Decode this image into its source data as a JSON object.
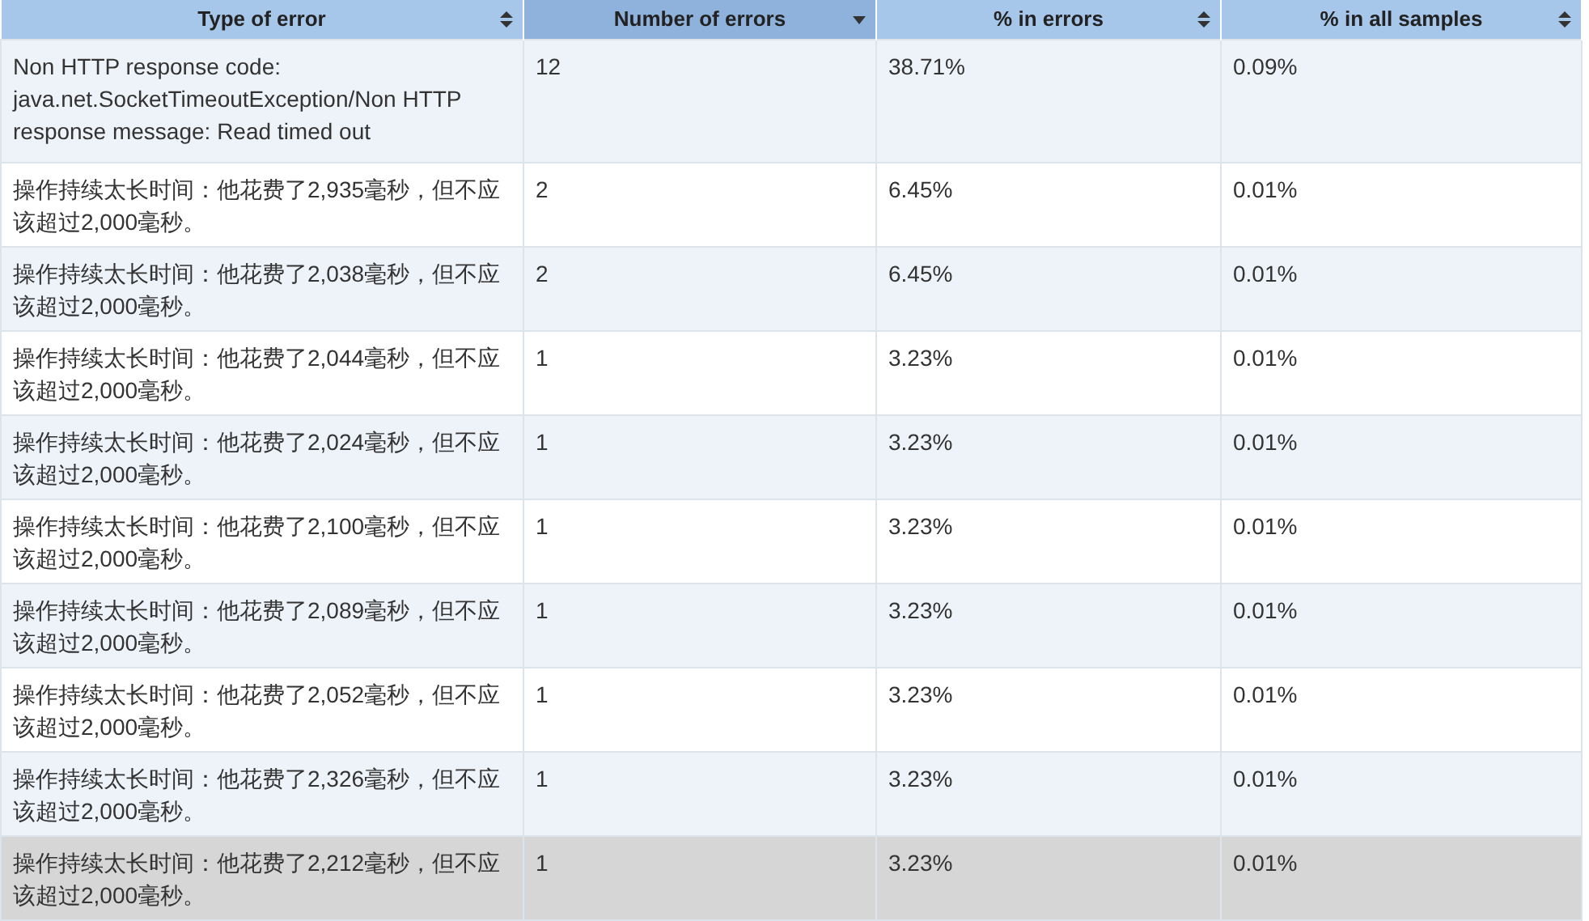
{
  "table": {
    "columns": [
      {
        "label": "Type of error",
        "sorted": false
      },
      {
        "label": "Number of errors",
        "sorted": true
      },
      {
        "label": "% in errors",
        "sorted": false
      },
      {
        "label": "% in all samples",
        "sorted": false
      }
    ],
    "rows": [
      {
        "cells": [
          "Non HTTP response code: java.net.SocketTimeoutException/Non HTTP response message: Read timed out",
          "12",
          "38.71%",
          "0.09%"
        ],
        "highlighted": false
      },
      {
        "cells": [
          "操作持续太长时间：他花费了2,935毫秒，但不应该超过2,000毫秒。",
          "2",
          "6.45%",
          "0.01%"
        ],
        "highlighted": false
      },
      {
        "cells": [
          "操作持续太长时间：他花费了2,038毫秒，但不应该超过2,000毫秒。",
          "2",
          "6.45%",
          "0.01%"
        ],
        "highlighted": false
      },
      {
        "cells": [
          "操作持续太长时间：他花费了2,044毫秒，但不应该超过2,000毫秒。",
          "1",
          "3.23%",
          "0.01%"
        ],
        "highlighted": false
      },
      {
        "cells": [
          "操作持续太长时间：他花费了2,024毫秒，但不应该超过2,000毫秒。",
          "1",
          "3.23%",
          "0.01%"
        ],
        "highlighted": false
      },
      {
        "cells": [
          "操作持续太长时间：他花费了2,100毫秒，但不应该超过2,000毫秒。",
          "1",
          "3.23%",
          "0.01%"
        ],
        "highlighted": false
      },
      {
        "cells": [
          "操作持续太长时间：他花费了2,089毫秒，但不应该超过2,000毫秒。",
          "1",
          "3.23%",
          "0.01%"
        ],
        "highlighted": false
      },
      {
        "cells": [
          "操作持续太长时间：他花费了2,052毫秒，但不应该超过2,000毫秒。",
          "1",
          "3.23%",
          "0.01%"
        ],
        "highlighted": false
      },
      {
        "cells": [
          "操作持续太长时间：他花费了2,326毫秒，但不应该超过2,000毫秒。",
          "1",
          "3.23%",
          "0.01%"
        ],
        "highlighted": false
      },
      {
        "cells": [
          "操作持续太长时间：他花费了2,212毫秒，但不应该超过2,000毫秒。",
          "1",
          "3.23%",
          "0.01%"
        ],
        "highlighted": true
      }
    ]
  }
}
